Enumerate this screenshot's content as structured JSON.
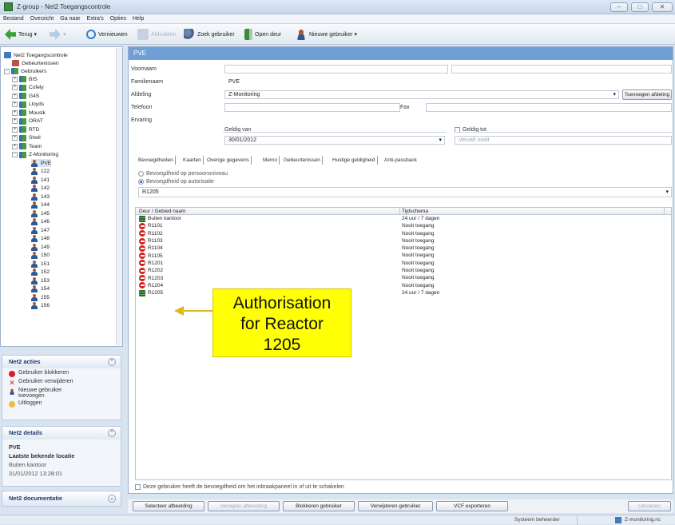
{
  "window": {
    "title": "Z-group - Net2 Toegangscontrole"
  },
  "menu": [
    "Bestand",
    "Overzicht",
    "Ga naar",
    "Extra's",
    "Opties",
    "Help"
  ],
  "toolbar": {
    "back": "Terug",
    "refresh": "Vernieuwen",
    "print": "Afdrukken",
    "find_user": "Zoek gebruiker",
    "open_door": "Open deur",
    "new_user": "Nieuwe gebruiker"
  },
  "tree": {
    "root": "Net2 Toegangscontrole",
    "events": "Gebeurtenissen",
    "users": "Gebruikers",
    "groups": [
      "BIS",
      "Cofely",
      "G4S",
      "Lloyds",
      "Mouslk",
      "ORAT",
      "RTD",
      "Shell",
      "Team"
    ],
    "open_group": "Z-Monitoring",
    "members": [
      "PVE",
      "122",
      "141",
      "142",
      "143",
      "144",
      "145",
      "146",
      "147",
      "148",
      "149",
      "150",
      "151",
      "152",
      "153",
      "154",
      "155",
      "156"
    ]
  },
  "actions": {
    "title": "Net2 acties",
    "items": [
      "Gebruiker blokkeren",
      "Gebruiker verwijderen",
      "Nieuwe gebruiker toevoegen",
      "Uitloggen"
    ]
  },
  "details": {
    "title": "Net2 details",
    "name": "PVE",
    "location_label": "Laatste bekende locatie",
    "location": "Buiten kantoor",
    "timestamp": "31/01/2012 13:28:01"
  },
  "docs": {
    "title": "Net2 documentatie"
  },
  "form": {
    "header": "PVE",
    "first_name_label": "Voornaam",
    "first_name": "",
    "last_name_label": "Familienaam",
    "last_name": "PVE",
    "dept_label": "Afdeling",
    "dept": "Z-Monitoring",
    "add_dept": "Toevoegen afdeling",
    "phone_label": "Telefoon",
    "fax_label": "Fax",
    "exp_label": "Ervaring",
    "valid_from_label": "Geldig van",
    "valid_from": "30/01/2012",
    "valid_to_label": "Geldig tot",
    "valid_to": "Vervalt nooit"
  },
  "tabs": [
    "Bevoegdheden",
    "Kaarten",
    "Overige gegevens",
    "Memo",
    "Gebeurtenissen",
    "Huidige geldigheid",
    "Anti-passback"
  ],
  "perm": {
    "individual": "Bevoegdheid op persoonsniveau",
    "by_auth": "Bevoegdheid op autorisatie",
    "selected": "R1205"
  },
  "grid": {
    "headers": [
      "Deur / Gebied naam",
      "Tijdschema"
    ],
    "rows": [
      {
        "name": "Buiten kantoor",
        "schedule": "24 uur / 7 dagen",
        "icon": "grn"
      },
      {
        "name": "R1101",
        "schedule": "Nooit toegang",
        "icon": "red"
      },
      {
        "name": "R1102",
        "schedule": "Nooit toegang",
        "icon": "red"
      },
      {
        "name": "R1103",
        "schedule": "Nooit toegang",
        "icon": "red"
      },
      {
        "name": "R1104",
        "schedule": "Nooit toegang",
        "icon": "red"
      },
      {
        "name": "R1105",
        "schedule": "Nooit toegang",
        "icon": "red"
      },
      {
        "name": "R1201",
        "schedule": "Nooit toegang",
        "icon": "red"
      },
      {
        "name": "R1202",
        "schedule": "Nooit toegang",
        "icon": "red"
      },
      {
        "name": "R1203",
        "schedule": "Nooit toegang",
        "icon": "red"
      },
      {
        "name": "R1204",
        "schedule": "Nooit toegang",
        "icon": "red"
      },
      {
        "name": "R1205",
        "schedule": "24 uur / 7 dagen",
        "icon": "grn"
      }
    ]
  },
  "intrusion_text": "Deze gebruiker heeft de bevoegdheid om het inbraakpaneel in of uit te schakelen",
  "buttons": [
    "Selecteer afbeelding",
    "Verwijder afbeelding",
    "Blokkeren gebruiker",
    "Verwijderen gebruiker",
    "VCF exporteren",
    "Uitvoeren"
  ],
  "annotation": [
    "Authorisation",
    "for Reactor",
    "1205"
  ],
  "status": {
    "user": "Systeem beheerder",
    "group": "Z-monitoring.nc"
  }
}
